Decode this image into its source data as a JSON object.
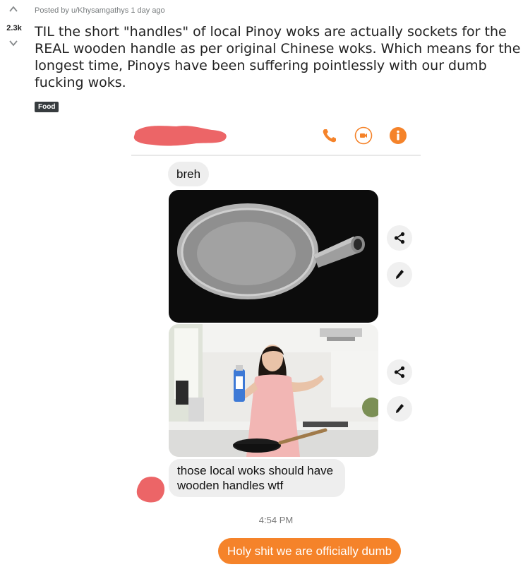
{
  "post": {
    "votes": "2.3k",
    "meta": "Posted by u/Khysamgathys 1 day ago",
    "title": "TIL the short \"handles\" of local Pinoy woks are actually sockets for the REAL wooden handle as per original Chinese woks. Which means for the longest time, Pinoys have been suffering pointlessly with our dumb fucking woks.",
    "flair": "Food"
  },
  "chat": {
    "header_icons": [
      "phone-icon",
      "video-icon",
      "info-icon"
    ],
    "accent_color": "#f5832a",
    "redaction_color": "#ec6567",
    "messages": [
      {
        "type": "incoming_text",
        "text": "breh"
      },
      {
        "type": "incoming_image",
        "content": "aluminum-wok-photo"
      },
      {
        "type": "incoming_image",
        "content": "woman-in-kitchen-photo"
      },
      {
        "type": "incoming_text",
        "text": "those local woks should have wooden handles wtf"
      }
    ],
    "timestamp": "4:54 PM",
    "outgoing": "Holy shit we are officially dumb",
    "action_icons": [
      "share-icon",
      "pencil-icon"
    ]
  }
}
